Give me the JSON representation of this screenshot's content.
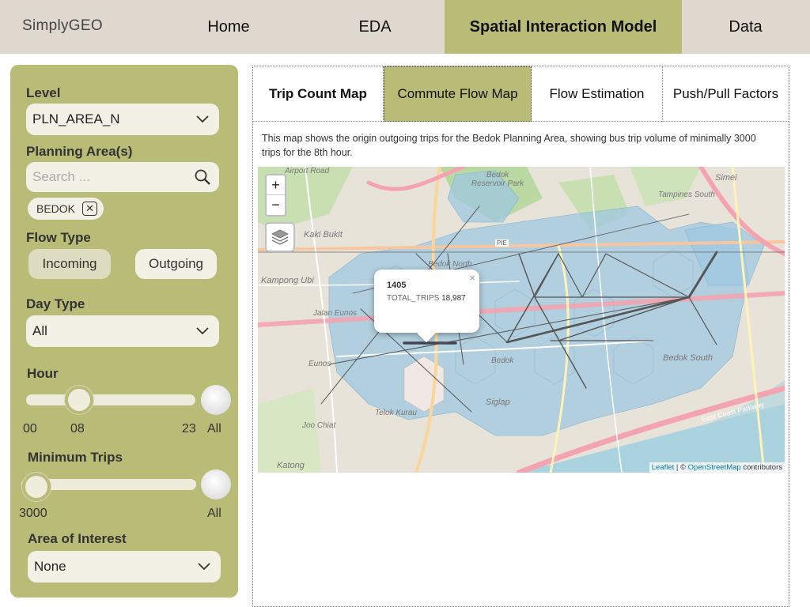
{
  "nav": {
    "brand": "SimplyGEO",
    "items": [
      "Home",
      "EDA",
      "Spatial Interaction Model",
      "Data"
    ],
    "active": "Spatial Interaction Model"
  },
  "sidebar": {
    "level_label": "Level",
    "level_value": "PLN_AREA_N",
    "planning_label": "Planning Area(s)",
    "search_placeholder": "Search ...",
    "selected_areas": [
      "BEDOK"
    ],
    "flow_type_label": "Flow Type",
    "flow_types": [
      "Incoming",
      "Outgoing"
    ],
    "flow_type_selected": "Incoming",
    "day_type_label": "Day Type",
    "day_type_value": "All",
    "hour_label": "Hour",
    "hour_ticks": [
      "00",
      "08",
      "23",
      "All"
    ],
    "hour_value": "08",
    "min_trips_label": "Minimum Trips",
    "min_trips_ticks": [
      "3000",
      "All"
    ],
    "min_trips_value": "3000",
    "aoi_label": "Area of Interest",
    "aoi_value": "None"
  },
  "main": {
    "tabs": [
      "Trip Count Map",
      "Commute Flow Map",
      "Flow Estimation",
      "Push/Pull Factors"
    ],
    "active_tab": "Commute Flow Map",
    "description": "This map shows the origin outgoing trips for the Bedok Planning Area, showing bus trip volume of minimally 3000 trips for the 8th hour."
  },
  "map": {
    "zoom_in": "+",
    "zoom_out": "−",
    "popup_title": "1405",
    "popup_key": "TOTAL_TRIPS",
    "popup_value": "18,987",
    "popup_close": "×",
    "attribution_leaflet": "Leaflet",
    "attribution_sep": " | © ",
    "attribution_osm": "OpenStreetMap",
    "attribution_tail": " contributors",
    "labels": [
      "Airport Road",
      "Bedok Reservoir Park",
      "Kaki Bukit",
      "Bedok North",
      "Kampong Ubi",
      "Jalan Eunos",
      "Eunos",
      "Bedok",
      "Siglap",
      "Telok Kurau",
      "Joo Chiat",
      "Katong",
      "Bedok South",
      "Tampines South",
      "Simei",
      "East Coast Parkway",
      "PIE"
    ]
  },
  "colors": {
    "accent": "#b9bc77",
    "nav_bg": "#dfd8cf",
    "hex_fill": "#9fc8e0"
  }
}
